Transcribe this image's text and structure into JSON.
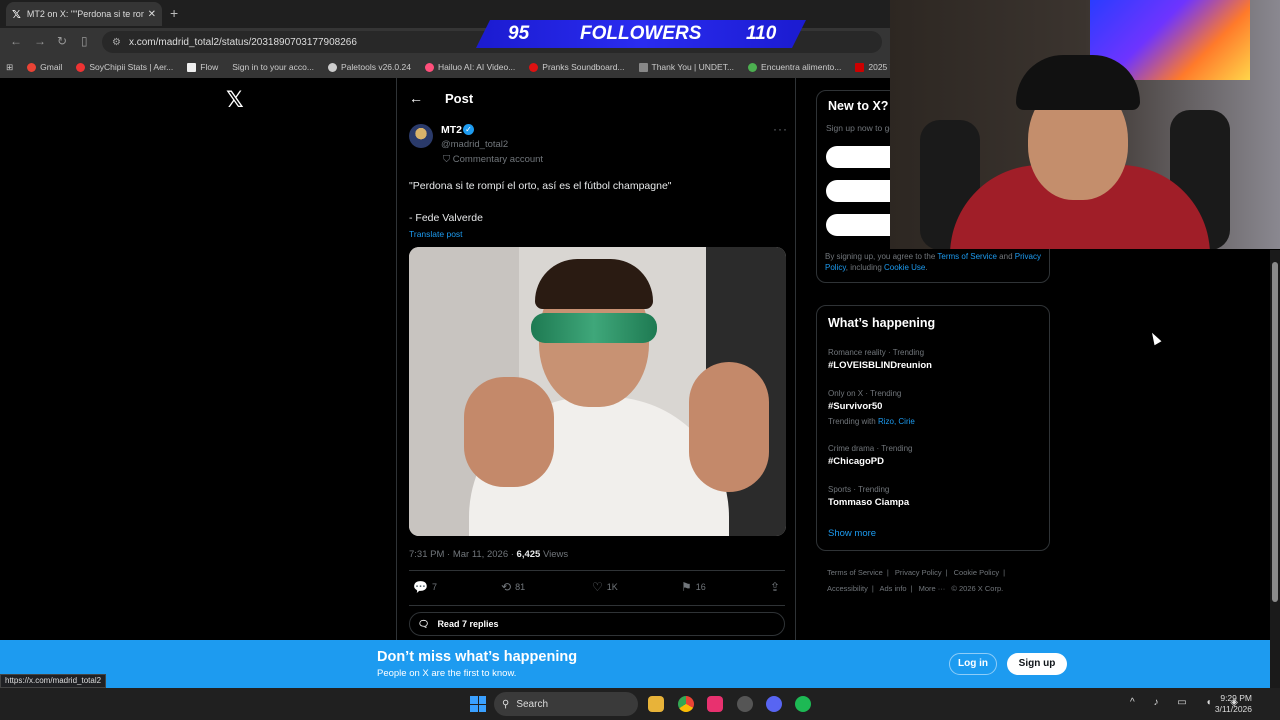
{
  "browser": {
    "tab_title": "MT2 on X: \"\"Perdona si te romp",
    "tab_close": "✕",
    "new_tab": "+",
    "url": "x.com/madrid_total2/status/2031890703177908266",
    "bookmarks": [
      "Gmail",
      "SoyChipii Stats | Aer...",
      "Flow",
      "Sign in to your acco...",
      "Paletools v26.0.24",
      "Hailuo AI: AI Video...",
      "Pranks Soundboard...",
      "Thank You | UNDET...",
      "Encuentra alimento...",
      "2025 Yamaha"
    ],
    "status_url": "https://x.com/madrid_total2"
  },
  "overlay": {
    "followers_left": "95",
    "followers_label": "FOLLOWERS",
    "followers_right": "110"
  },
  "post": {
    "header": "Post",
    "author_name": "MT2",
    "handle": "@madrid_total2",
    "commentary": "Commentary account",
    "quote": "\"Perdona si te rompí el orto, así es el fútbol champagne\"",
    "signature": "- Fede Valverde",
    "translate": "Translate post",
    "time": "7:31 PM · Mar 11, 2026 · ",
    "views_count": "6,425",
    "views_label": " Views",
    "replies": "7",
    "reposts": "81",
    "likes": "1K",
    "bookmarks": "16",
    "read_replies": "Read 7 replies"
  },
  "sidebar": {
    "new_title": "New to X?",
    "new_sub": "Sign up now to get your own personalized timeline!",
    "terms_prefix": "By signing up, you agree to the ",
    "terms_link": "Terms of Service",
    "terms_and": " and ",
    "privacy_link": "Privacy Policy",
    "terms_including": ", including ",
    "cookie_link": "Cookie Use",
    "terms_end": ".",
    "happening_title": "What’s happening",
    "trends": [
      {
        "meta": "Romance reality · Trending",
        "tag": "#LOVEISBLINDreunion"
      },
      {
        "meta": "Only on X · Trending",
        "tag": "#Survivor50",
        "with_label": "Trending with ",
        "with_links": "Rizo, Cirie"
      },
      {
        "meta": "Crime drama · Trending",
        "tag": "#ChicagoPD"
      },
      {
        "meta": "Sports · Trending",
        "tag": "Tommaso Ciampa"
      }
    ],
    "show_more": "Show more",
    "footer": [
      "Terms of Service",
      "|",
      "Privacy Policy",
      "|",
      "Cookie Policy",
      "|",
      "Accessibility",
      "|",
      "Ads info",
      "|",
      "More ···",
      "© 2026 X Corp."
    ]
  },
  "banner": {
    "title": "Don’t miss what’s happening",
    "sub": "People on X are the first to know.",
    "login": "Log in",
    "signup": "Sign up"
  },
  "taskbar": {
    "search": "Search",
    "time": "9:29 PM",
    "date": "3/11/2026"
  }
}
